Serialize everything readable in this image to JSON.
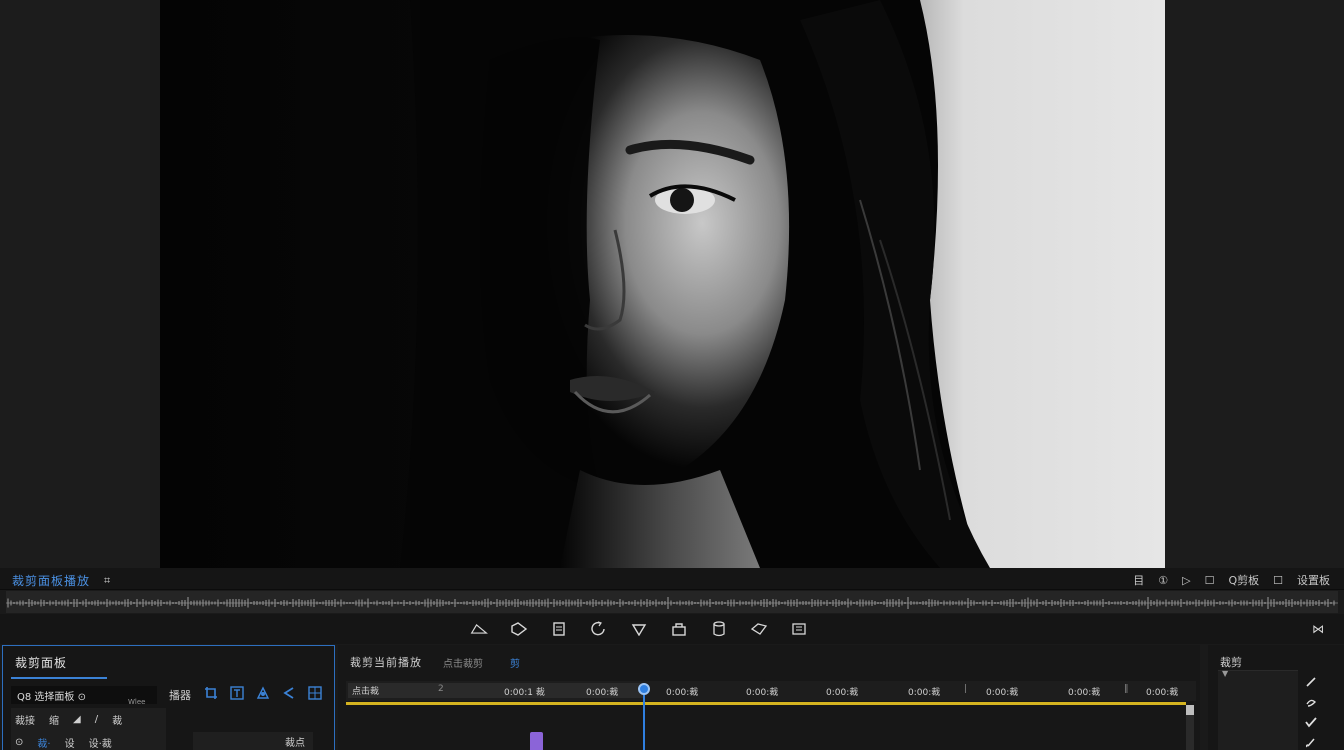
{
  "viewer": {
    "image_description": "black and white portrait"
  },
  "header": {
    "title": "裁剪面板播放",
    "title_icon": "frame-icon",
    "right_items": [
      {
        "icon": "list-icon",
        "label": "目"
      },
      {
        "icon": "info-icon",
        "label": "①"
      },
      {
        "icon": "play-icon",
        "label": "▷"
      },
      {
        "icon": "save-icon",
        "label": "☐"
      },
      {
        "icon": "none",
        "label": "Q剪板"
      },
      {
        "icon": "monitor-icon",
        "label": "☐"
      },
      {
        "icon": "none",
        "label": "设置板"
      }
    ]
  },
  "toolbar": {
    "icons": [
      "shape-icon",
      "tag-icon",
      "clipboard-icon",
      "rotate-icon",
      "heart-icon",
      "lock-icon",
      "cylinder-icon",
      "link-icon",
      "text-icon"
    ],
    "right_label": "⋈"
  },
  "left_panel": {
    "title": "裁剪面板",
    "field_value": "Q8 选择面板 ⊙",
    "field_hint": "Wlee",
    "label": "播器",
    "icons": [
      "crop-icon",
      "text-crop-icon",
      "target-icon",
      "arrow-left-icon",
      "grid-icon"
    ],
    "rows": [
      {
        "a": "裁接",
        "b": "缩",
        "c": "◢",
        "d": "/",
        "e": "裁"
      },
      {
        "a": "⊙",
        "b": "裁·",
        "c": "设",
        "d": "设·裁"
      }
    ],
    "dimension_label": "裁点"
  },
  "timeline": {
    "title": "裁剪当前播放",
    "subtitle": "点击裁剪",
    "icon_label": "剪",
    "header_first": "点击裁",
    "labels": [
      "0:00:1 裁",
      "0:00:裁",
      "0:00:裁",
      "0:00:裁",
      "0:00:裁",
      "0:00:裁",
      "0:00:裁",
      "0:00:裁",
      "0:00:裁",
      "0:00:裁"
    ],
    "separators": [
      "2",
      "|",
      "‖"
    ],
    "colors": {
      "playhead": "#2f7fe0",
      "work_area": "#d4b320",
      "clip": "#8b64d8"
    }
  },
  "right_panel": {
    "title": "裁剪",
    "marker": "▼",
    "icons": [
      "pen-icon",
      "lasso-icon",
      "check-icon",
      "brush-icon"
    ]
  }
}
